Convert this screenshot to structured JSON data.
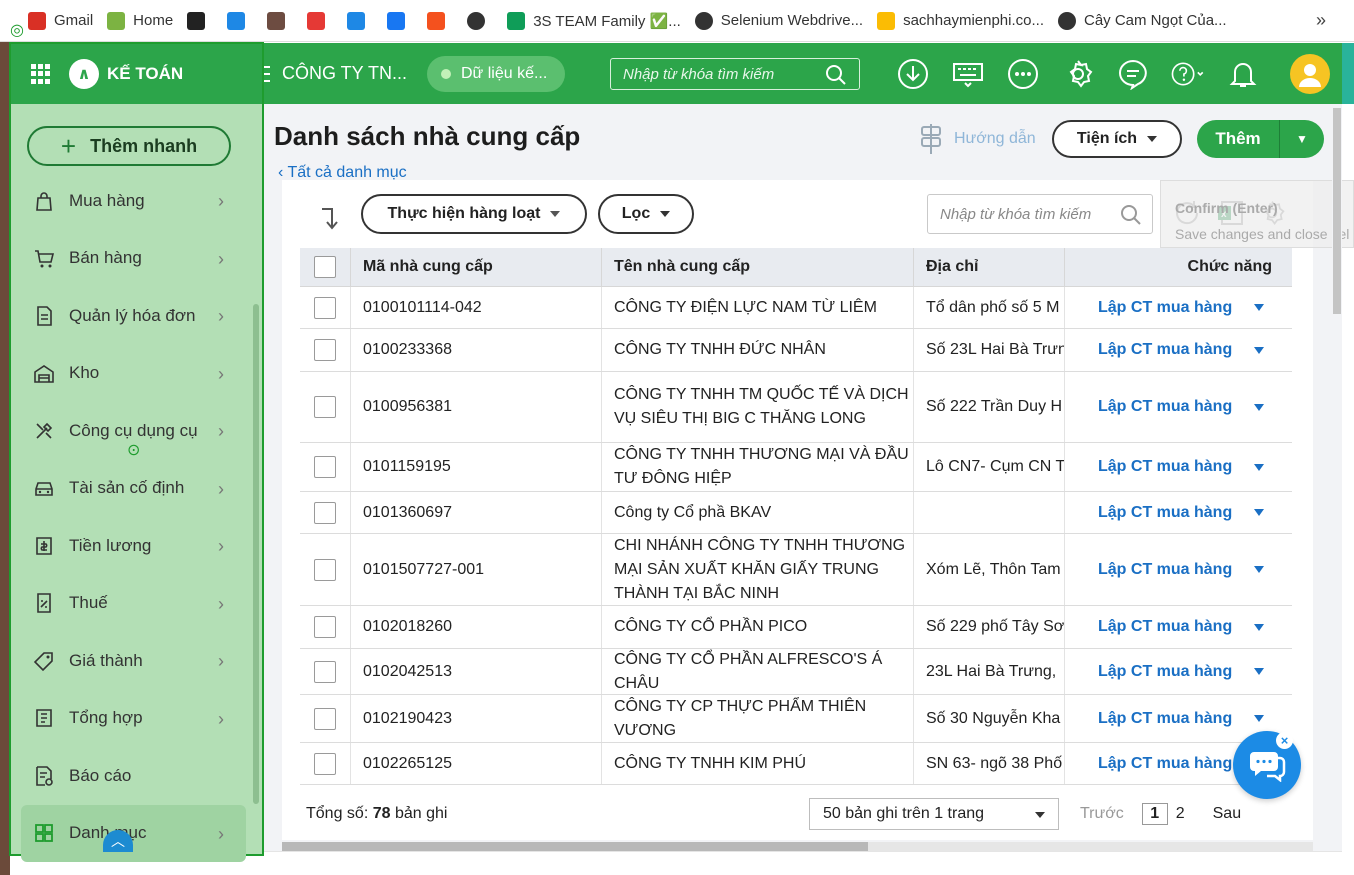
{
  "bookmarks": [
    {
      "label": "Gmail",
      "icon": "gmail-icon",
      "color": "#d93025"
    },
    {
      "label": "Home",
      "icon": "home-gear-icon",
      "color": "#7cb342"
    },
    {
      "label": "",
      "icon": "bookmark-icon-1",
      "color": "#222222"
    },
    {
      "label": "",
      "icon": "bookmark-icon-2",
      "color": "#1e88e5"
    },
    {
      "label": "",
      "icon": "bookmark-icon-3",
      "color": "#6d4c41"
    },
    {
      "label": "",
      "icon": "cloud-icon",
      "color": "#e53935"
    },
    {
      "label": "",
      "icon": "people-icon",
      "color": "#1e88e5"
    },
    {
      "label": "",
      "icon": "facebook-icon",
      "color": "#1877f2"
    },
    {
      "label": "",
      "icon": "bookmark-icon-4",
      "color": "#f4511e"
    },
    {
      "label": "",
      "icon": "globe-icon",
      "color": "#333333"
    },
    {
      "label": "3S TEAM Family ✅...",
      "icon": "sheets-icon",
      "color": "#0f9d58"
    },
    {
      "label": "Selenium Webdrive...",
      "icon": "google-g-icon",
      "color": "#333333"
    },
    {
      "label": "sachhaymienphi.co...",
      "icon": "drive-icon",
      "color": "#fbbc04"
    },
    {
      "label": "Cây Cam Ngọt Của...",
      "icon": "globe-icon",
      "color": "#333333"
    }
  ],
  "bookmark_more": "»",
  "sidebar": {
    "logo_text": "KẾ TOÁN",
    "quick_add": "Thêm nhanh",
    "items": [
      {
        "label": "Mua hàng",
        "icon": "shopping-bag-icon"
      },
      {
        "label": "Bán hàng",
        "icon": "cart-icon"
      },
      {
        "label": "Quản lý hóa đơn",
        "icon": "invoice-icon"
      },
      {
        "label": "Kho",
        "icon": "warehouse-icon"
      },
      {
        "label": "Công cụ dụng cụ",
        "icon": "tools-icon"
      },
      {
        "label": "Tài sản cố định",
        "icon": "car-icon"
      },
      {
        "label": "Tiền lương",
        "icon": "salary-icon"
      },
      {
        "label": "Thuế",
        "icon": "tax-icon"
      },
      {
        "label": "Giá thành",
        "icon": "price-tag-icon"
      },
      {
        "label": "Tổng hợp",
        "icon": "summary-icon"
      },
      {
        "label": "Báo cáo",
        "icon": "report-icon"
      },
      {
        "label": "Danh mục",
        "icon": "category-grid-icon"
      }
    ]
  },
  "header": {
    "company": "CÔNG TY TN...",
    "data_pill": "Dữ liệu kế...",
    "search_placeholder": "Nhập từ khóa tìm kiếm"
  },
  "page": {
    "title": "Danh sách nhà cung cấp",
    "back_link": "Tất cả danh mục",
    "guide": "Hướng dẫn",
    "util_button": "Tiện ích",
    "add_button": "Thêm",
    "bulk_button": "Thực hiện hàng loạt",
    "filter_button": "Lọc",
    "table_search_placeholder": "Nhập từ khóa tìm kiếm",
    "tooltip_title": "Confirm (Enter)",
    "tooltip_sub": "Save changes and close sel"
  },
  "table": {
    "headers": [
      "Mã nhà cung cấp",
      "Tên nhà cung cấp",
      "Địa chỉ",
      "Chức năng"
    ],
    "action_label": "Lập CT mua hàng",
    "rows": [
      {
        "code": "0100101114-042",
        "name": "CÔNG TY ĐIỆN LỰC NAM TỪ LIÊM",
        "addr": "Tổ dân phố số 5 M"
      },
      {
        "code": "0100233368",
        "name": "CÔNG TY TNHH ĐỨC NHÂN",
        "addr": "Số 23L Hai Bà Trưn"
      },
      {
        "code": "0100956381",
        "name": "CÔNG TY TNHH TM QUỐC TẾ VÀ DỊCH VỤ SIÊU THỊ BIG C THĂNG LONG",
        "addr": "Số 222 Trần Duy H"
      },
      {
        "code": "0101159195",
        "name": "CÔNG TY TNHH THƯƠNG MẠI VÀ ĐẦU TƯ ĐÔNG HIỆP",
        "addr": "Lô CN7- Cụm CN T"
      },
      {
        "code": "0101360697",
        "name": "Công ty Cổ phầ BKAV",
        "addr": ""
      },
      {
        "code": "0101507727-001",
        "name": "CHI NHÁNH CÔNG TY TNHH THƯƠNG MẠI SẢN XUẤT KHĂN GIẤY TRUNG THÀNH TẠI BẮC NINH",
        "addr": "Xóm Lẽ, Thôn Tam"
      },
      {
        "code": "0102018260",
        "name": "CÔNG TY CỔ PHẦN PICO",
        "addr": "Số 229 phố Tây Sơ"
      },
      {
        "code": "0102042513",
        "name": "CÔNG TY CỔ PHẦN ALFRESCO'S Á CHÂU",
        "addr": "23L Hai Bà Trưng,"
      },
      {
        "code": "0102190423",
        "name": "CÔNG TY CP THỰC PHẨM THIÊN VƯƠNG",
        "addr": "Số 30 Nguyễn Kha"
      },
      {
        "code": "0102265125",
        "name": "CÔNG TY TNHH KIM PHÚ",
        "addr": "SN 63- ngõ 38 Phố"
      }
    ]
  },
  "footer": {
    "total_prefix": "Tổng số:",
    "total_count": "78",
    "total_suffix": "bản ghi",
    "per_page": "50 bản ghi trên 1 trang",
    "prev": "Trước",
    "page_current": "1",
    "page_next": "2",
    "next": "Sau"
  },
  "colors": {
    "brand_green": "#2ca54a",
    "link_blue": "#1a6fc4",
    "sidebar_bg": "#b3dfb5"
  }
}
